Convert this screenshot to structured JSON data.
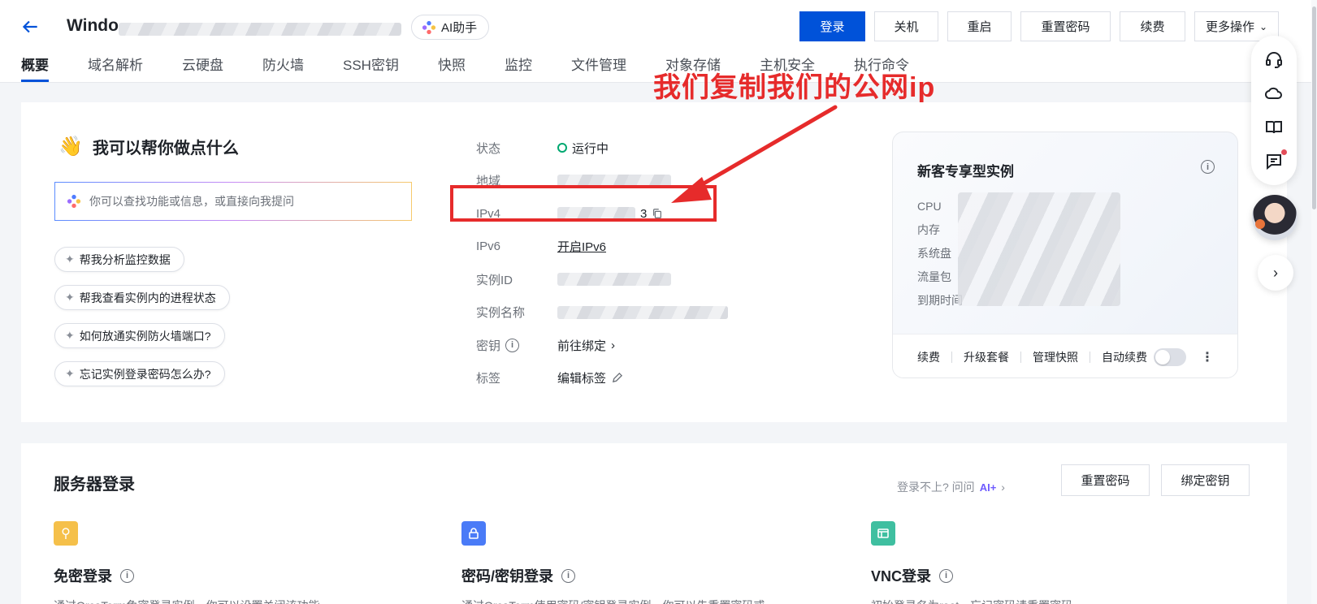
{
  "header": {
    "title": "Windo",
    "ai_button": "AI助手",
    "actions": [
      "登录",
      "关机",
      "重启",
      "重置密码",
      "续费",
      "更多操作"
    ],
    "tabs": [
      "概要",
      "域名解析",
      "云硬盘",
      "防火墙",
      "SSH密钥",
      "快照",
      "监控",
      "文件管理",
      "对象存储",
      "主机安全",
      "执行命令"
    ],
    "active_tab": "概要"
  },
  "assistant": {
    "title": "我可以帮你做点什么",
    "placeholder": "你可以查找功能或信息，或直接向我提问",
    "suggestions": [
      "帮我分析监控数据",
      "帮我查看实例内的进程状态",
      "如何放通实例防火墙端口?",
      "忘记实例登录密码怎么办?"
    ]
  },
  "instance_info": {
    "labels": {
      "status": "状态",
      "region": "地域",
      "ipv4": "IPv4",
      "ipv6": "IPv6",
      "instance_id": "实例ID",
      "instance_name": "实例名称",
      "key": "密钥",
      "tags": "标签"
    },
    "status_value": "运行中",
    "ipv4_suffix": "3",
    "ipv6_value": "开启IPv6",
    "key_value": "前往绑定",
    "tags_value": "编辑标签"
  },
  "promo": {
    "title": "新客专享型实例",
    "specs": [
      "CPU",
      "内存",
      "系统盘",
      "流量包",
      "到期时间"
    ],
    "footer": [
      "续费",
      "升级套餐",
      "管理快照",
      "自动续费"
    ]
  },
  "server_login": {
    "title": "服务器登录",
    "help_text": "登录不上? 问问",
    "help_ai": "AI+",
    "buttons": [
      "重置密码",
      "绑定密钥"
    ],
    "methods": [
      {
        "title": "免密登录",
        "desc": "通过OrcaTerm免密登录实例，你可以设置关闭该功能"
      },
      {
        "title": "密码/密钥登录",
        "desc": "通过OrcaTerm使用密码/密钥登录实例，你可以先重置密码或"
      },
      {
        "title": "VNC登录",
        "desc": "初始登录名为root，忘记密码请重置密码"
      }
    ]
  },
  "annotation": {
    "text": "我们复制我们的公网ip"
  },
  "colors": {
    "primary": "#0052d9",
    "annotation_red": "#e62b2b",
    "running_green": "#00a870"
  }
}
